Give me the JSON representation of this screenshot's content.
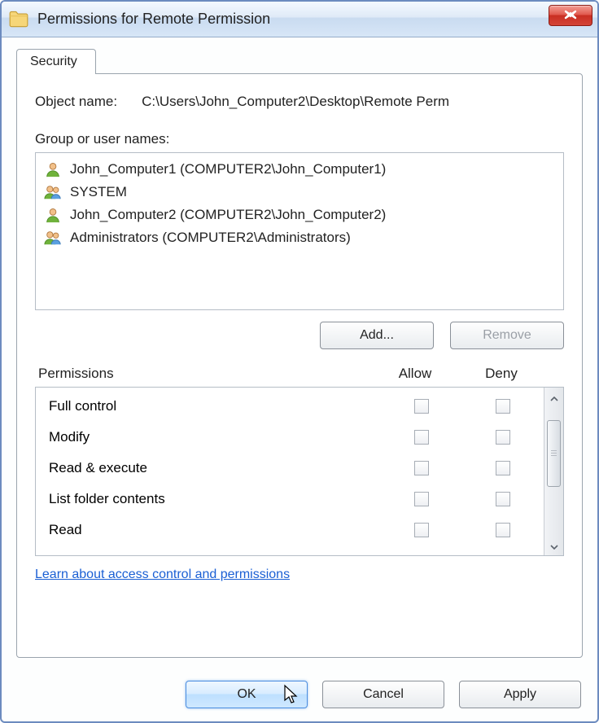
{
  "titlebar": {
    "title": "Permissions for Remote Permission"
  },
  "tab": {
    "label": "Security"
  },
  "object": {
    "label": "Object name:",
    "value": "C:\\Users\\John_Computer2\\Desktop\\Remote Perm"
  },
  "groupLabel": "Group or user names:",
  "users": [
    {
      "name": "John_Computer1 (COMPUTER2\\John_Computer1)",
      "type": "user"
    },
    {
      "name": "SYSTEM",
      "type": "group"
    },
    {
      "name": "John_Computer2 (COMPUTER2\\John_Computer2)",
      "type": "user"
    },
    {
      "name": "Administrators (COMPUTER2\\Administrators)",
      "type": "group"
    }
  ],
  "buttons": {
    "add": "Add...",
    "remove": "Remove",
    "ok": "OK",
    "cancel": "Cancel",
    "apply": "Apply"
  },
  "permHeader": {
    "name": "Permissions",
    "allow": "Allow",
    "deny": "Deny"
  },
  "permissions": [
    {
      "name": "Full control"
    },
    {
      "name": "Modify"
    },
    {
      "name": "Read & execute"
    },
    {
      "name": "List folder contents"
    },
    {
      "name": "Read"
    }
  ],
  "link": "Learn about access control and permissions"
}
